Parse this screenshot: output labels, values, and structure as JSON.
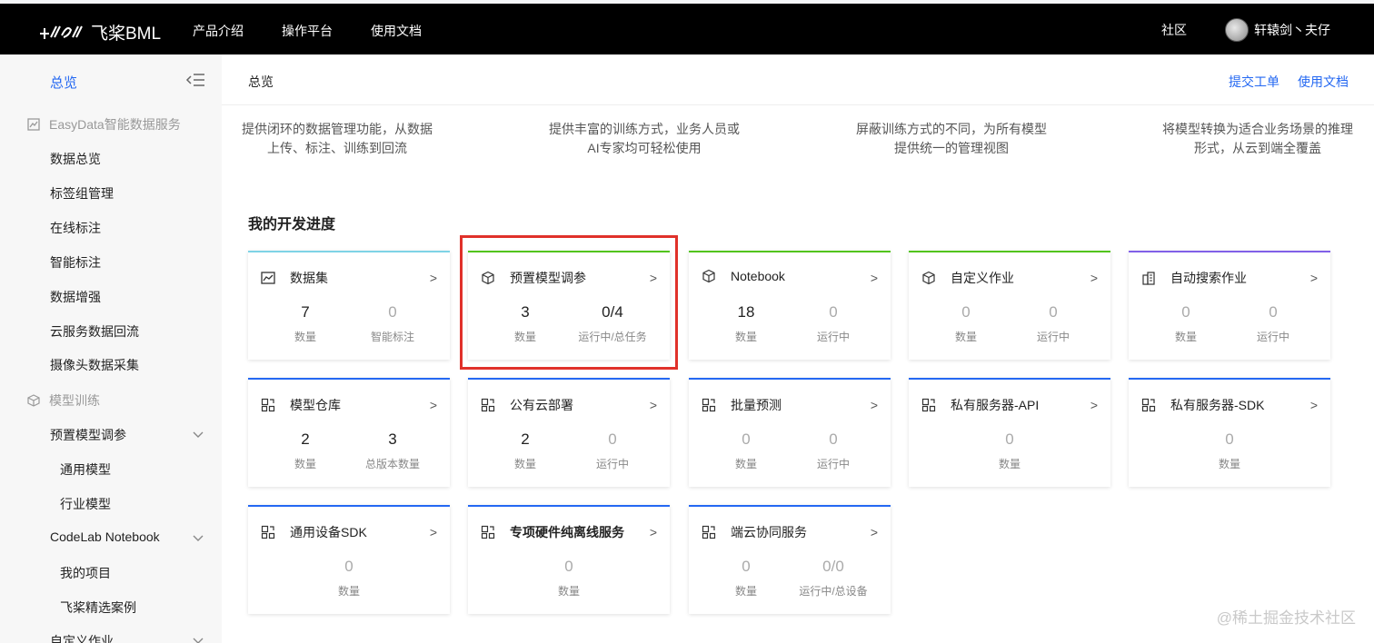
{
  "app": {
    "logo_text": "飞桨BML"
  },
  "topnav": {
    "items": [
      "产品介绍",
      "操作平台",
      "使用文档"
    ],
    "community": "社区",
    "user": "轩辕剑丶夫仔"
  },
  "sidebar": {
    "head": "总览",
    "groups": [
      {
        "label": "EasyData智能数据服务",
        "items": [
          "数据总览",
          "标签组管理",
          "在线标注",
          "智能标注",
          "数据增强",
          "云服务数据回流",
          "摄像头数据采集"
        ]
      },
      {
        "label": "模型训练"
      }
    ],
    "train_items": {
      "preset": "预置模型调参",
      "preset_sub": [
        "通用模型",
        "行业模型"
      ],
      "codelab": "CodeLab Notebook",
      "codelab_sub": [
        "我的项目",
        "飞桨精选案例"
      ],
      "custom": "自定义作业"
    }
  },
  "header": {
    "crumb": "总览",
    "links": [
      "提交工单",
      "使用文档"
    ]
  },
  "intros": [
    [
      "提供闭环的数据管理功能，从数据",
      "上传、标注、训练到回流"
    ],
    [
      "提供丰富的训练方式，业务人员或",
      "AI专家均可轻松使用"
    ],
    [
      "屏蔽训练方式的不同，为所有模型",
      "提供统一的管理视图"
    ],
    [
      "将模型转换为适合业务场景的推理",
      "形式，从云到端全覆盖"
    ]
  ],
  "section_title": "我的开发进度",
  "cards": [
    {
      "title": "数据集",
      "icon": "chart-icon",
      "color": "#7ed3e6",
      "stats": [
        {
          "v": "7",
          "l": "数量"
        },
        {
          "v": "0",
          "l": "智能标注"
        }
      ]
    },
    {
      "title": "预置模型调参",
      "icon": "cube-icon",
      "color": "#52c41a",
      "stats": [
        {
          "v": "3",
          "l": "数量"
        },
        {
          "v": "0/4",
          "l": "运行中/总任务"
        }
      ]
    },
    {
      "title": "Notebook",
      "icon": "cube-icon",
      "color": "#52c41a",
      "stats": [
        {
          "v": "18",
          "l": "数量"
        },
        {
          "v": "0",
          "l": "运行中"
        }
      ]
    },
    {
      "title": "自定义作业",
      "icon": "cube-icon",
      "color": "#52c41a",
      "stats": [
        {
          "v": "0",
          "l": "数量"
        },
        {
          "v": "0",
          "l": "运行中"
        }
      ]
    },
    {
      "title": "自动搜索作业",
      "icon": "building-icon",
      "color": "#8160e8",
      "stats": [
        {
          "v": "0",
          "l": "数量"
        },
        {
          "v": "0",
          "l": "运行中"
        }
      ]
    },
    {
      "title": "模型仓库",
      "icon": "deploy-icon",
      "color": "#2468f2",
      "stats": [
        {
          "v": "2",
          "l": "数量"
        },
        {
          "v": "3",
          "l": "总版本数量"
        }
      ]
    },
    {
      "title": "公有云部署",
      "icon": "deploy-icon",
      "color": "#2468f2",
      "stats": [
        {
          "v": "2",
          "l": "数量"
        },
        {
          "v": "0",
          "l": "运行中"
        }
      ]
    },
    {
      "title": "批量预测",
      "icon": "deploy-icon",
      "color": "#2468f2",
      "stats": [
        {
          "v": "0",
          "l": "数量"
        },
        {
          "v": "0",
          "l": "运行中"
        }
      ]
    },
    {
      "title": "私有服务器-API",
      "icon": "deploy-icon",
      "color": "#2468f2",
      "stats": [
        {
          "v": "0",
          "l": "数量"
        }
      ]
    },
    {
      "title": "私有服务器-SDK",
      "icon": "deploy-icon",
      "color": "#2468f2",
      "stats": [
        {
          "v": "0",
          "l": "数量"
        }
      ]
    },
    {
      "title": "通用设备SDK",
      "icon": "deploy-icon",
      "color": "#2468f2",
      "stats": [
        {
          "v": "0",
          "l": "数量"
        }
      ]
    },
    {
      "title": "专项硬件纯离线服务",
      "icon": "deploy-icon",
      "color": "#2468f2",
      "stats": [
        {
          "v": "0",
          "l": "数量"
        }
      ]
    },
    {
      "title": "端云协同服务",
      "icon": "deploy-icon",
      "color": "#2468f2",
      "stats": [
        {
          "v": "0",
          "l": "数量"
        },
        {
          "v": "0/0",
          "l": "运行中/总设备"
        }
      ]
    }
  ],
  "arrow": ">",
  "watermark": "@稀土掘金技术社区"
}
